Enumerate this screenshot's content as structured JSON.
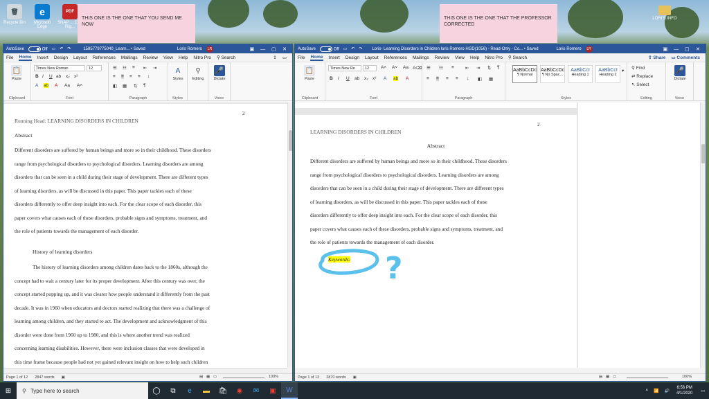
{
  "desktop": {
    "icons": [
      {
        "label": "Recycle Bin",
        "glyph": "🗑"
      },
      {
        "label": "Microsoft Edge",
        "glyph": "e"
      },
      {
        "label": "SNAP ... Civil Rig...",
        "glyph": "PDF"
      }
    ],
    "stickies": [
      {
        "text": "THIS ONE IS THE ONE THAT YOU SEND ME NOW"
      },
      {
        "text": "THIS ONE IS THE ONE THAT THE PROFESSOR CORRECTED"
      }
    ],
    "folder_label": "LORI'S INFO"
  },
  "left_window": {
    "title": {
      "autosave": "AutoSave",
      "toggle": "Off",
      "doc_name": "1585779775040_Learn... • Saved",
      "user": "Loris Romero",
      "initials": "LR"
    },
    "tabs": [
      "File",
      "Home",
      "Insert",
      "Design",
      "Layout",
      "References",
      "Mailings",
      "Review",
      "View",
      "Help",
      "Nitro Pro"
    ],
    "search": "Search",
    "ribbon": {
      "font_name": "Times New Roman",
      "font_size": "12",
      "paste": "Paste",
      "styles": "Styles",
      "editing": "Editing",
      "dictate": "Dictate",
      "group_clipboard": "Clipboard",
      "group_font": "Font",
      "group_paragraph": "Paragraph",
      "group_styles": "Styles",
      "group_voice": "Voice"
    },
    "page_number": "2",
    "running_head": "Running Head: LEARNING DISORDERS IN CHILDREN",
    "abstract_heading": "Abstract",
    "paragraph_lines": [
      "Different disorders are suffered by human beings and more so in their childhood. These disorders",
      "range from psychological disorders to psychological disorders. Learning disorders are among",
      "disorders that can be seen in a child during their stage of development. There are different types",
      "of learning disorders, as will be discussed in this paper. This paper tackles each of these",
      "disorders differently to offer deep insight into each. For the clear scope of each disorder, this",
      "paper covers what causes each of these disorders, probable signs and symptoms, treatment, and",
      "the role of patients towards the management of each disorder."
    ],
    "history_heading": "History of learning disorders",
    "history_lines": [
      "The history of learning disorders among children dates back to the 1860s, although the",
      "concept had to wait a century later for its proper development. After this century was over, the",
      "concept started popping up, and it was clearer how people understand it differently from the past",
      "decade. It was in 1960 when educators and doctors started realizing that there was a challenge of",
      "learning among children, and they started to act. The development and acknowledgment of this",
      "disorder were done from 1960 up to 1980, and this is where another trend was realized",
      "concerning learning disabilities. However, there were inclusion classes that were developed in",
      "this time frame because people had not yet gained relevant insight on how to help such children"
    ],
    "status": {
      "page": "Page 1 of 12",
      "words": "2847 words",
      "zoom": "100%"
    }
  },
  "right_window": {
    "title": {
      "autosave": "AutoSave",
      "toggle": "Off",
      "doc_name": "Loris- Learning Disorders in Children loris Romero HGD(1056) - Read-Only - Co... • Saved",
      "user": "Loris Romero",
      "initials": "LR"
    },
    "tabs": [
      "File",
      "Home",
      "Insert",
      "Design",
      "Layout",
      "References",
      "Mailings",
      "Review",
      "View",
      "Help",
      "Nitro Pro"
    ],
    "search": "Search",
    "share": "Share",
    "comments": "Comments",
    "ribbon": {
      "font_name": "Times New Ro",
      "font_size": "12",
      "paste": "Paste",
      "style_cards": [
        {
          "preview": "AaBbCcDc",
          "name": "¶ Normal"
        },
        {
          "preview": "AaBbCcDc",
          "name": "¶ No Spac..."
        },
        {
          "preview": "AaBbCcI",
          "name": "Heading 1"
        },
        {
          "preview": "AaBbCcI",
          "name": "Heading 2"
        }
      ],
      "find": "Find",
      "replace": "Replace",
      "select": "Select",
      "dictate": "Dictate",
      "group_clipboard": "Clipboard",
      "group_font": "Font",
      "group_paragraph": "Paragraph",
      "group_styles": "Styles",
      "group_editing": "Editing",
      "group_voice": "Voice"
    },
    "page_number": "2",
    "running_head": "LEARNING DISORDERS IN CHILDREN",
    "abstract_heading": "Abstract",
    "paragraph_lines": [
      "Different disorders are suffered by human beings and more so in their childhood. These disorders",
      "range from psychological disorders to psychological disorders. Learning disorders are among",
      "disorders that can be seen in a child during their stage of development. There are different types",
      "of learning disorders, as will be discussed in this paper. This paper tackles each of these",
      "disorders differently to offer deep insight into each. For the clear scope of each disorder, this",
      "paper covers what causes each of these disorders, probable signs and symptoms, treatment, and",
      "the role of patients towards the management of each disorder."
    ],
    "keywords": "Keywords:",
    "annotation_mark": "?",
    "status": {
      "page": "Page 1 of 13",
      "words": "2870 words",
      "zoom": "100%"
    }
  },
  "taskbar": {
    "search_placeholder": "Type here to search",
    "time": "6:56 PM",
    "date": "4/1/2020"
  },
  "colors": {
    "word_blue": "#2b579a",
    "sticky_pink": "#f6d3de",
    "highlight_yellow": "#ffff00",
    "annotation_blue": "#5bc0eb"
  }
}
